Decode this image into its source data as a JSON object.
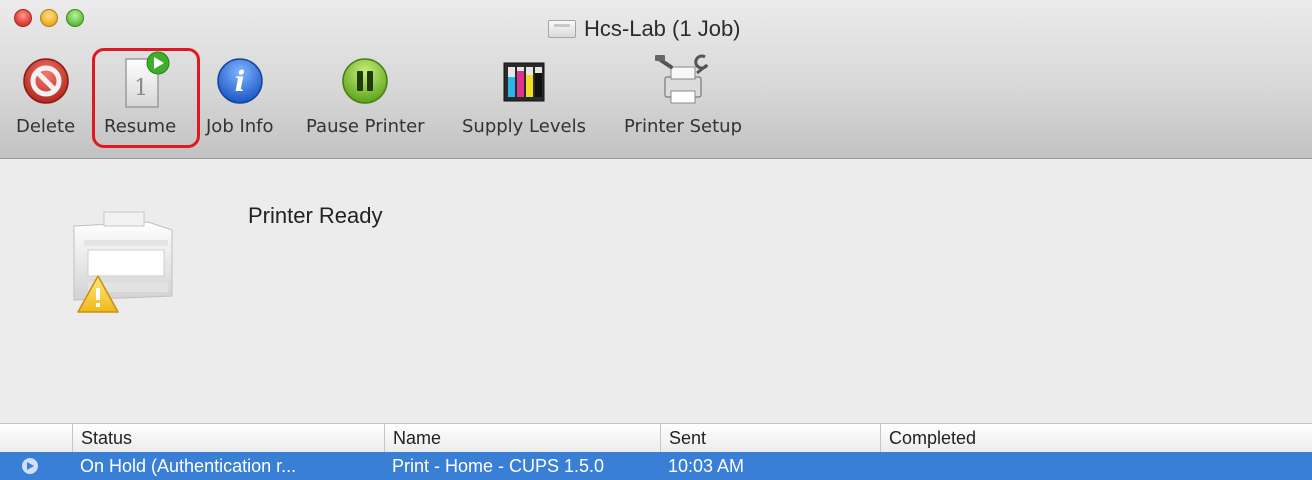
{
  "window": {
    "title": "Hcs-Lab (1 Job)"
  },
  "toolbar": {
    "delete_label": "Delete",
    "resume_label": "Resume",
    "job_info_label": "Job Info",
    "pause_printer_label": "Pause Printer",
    "supply_levels_label": "Supply Levels",
    "printer_setup_label": "Printer Setup",
    "resume_page_number": "1"
  },
  "status": {
    "message": "Printer Ready"
  },
  "jobs_table": {
    "columns": [
      "Status",
      "Name",
      "Sent",
      "Completed"
    ],
    "rows": [
      {
        "status": "On Hold (Authentication r...",
        "name": "Print - Home - CUPS 1.5.0",
        "sent": "10:03 AM",
        "completed": ""
      }
    ]
  },
  "colors": {
    "highlight": "#e0181f",
    "selection": "#3a7fd6"
  }
}
